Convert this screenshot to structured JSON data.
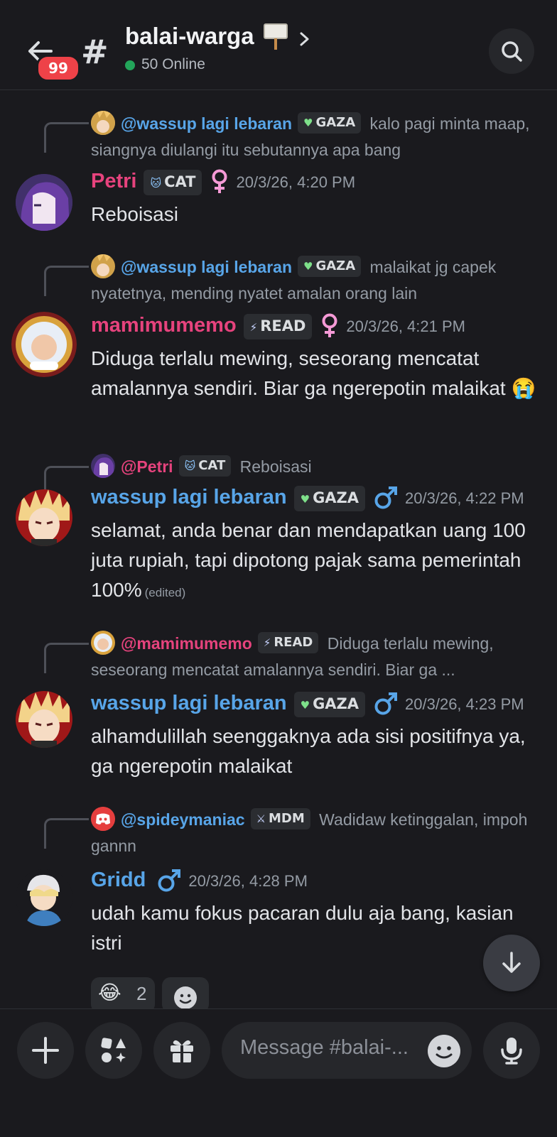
{
  "header": {
    "unread_count": "99",
    "channel_name": "balai-warga",
    "online_text": "50 Online"
  },
  "messages": [
    {
      "reply": {
        "name": "@wassup lagi lebaran",
        "tag": "GAZA",
        "text": "kalo pagi minta maap, siangnya diulangi itu sebutannya apa bang"
      },
      "author": "Petri",
      "tag": "CAT",
      "timestamp": "20/3/26, 4:20 PM",
      "text": "Reboisasi"
    },
    {
      "reply": {
        "name": "@wassup lagi lebaran",
        "tag": "GAZA",
        "text": "malaikat jg capek nyatetnya, mending nyatet amalan orang lain"
      },
      "author": "mamimumemo",
      "tag": "READ",
      "timestamp": "20/3/26, 4:21 PM",
      "text": "Diduga terlalu mewing, seseorang mencatat amalannya sendiri. Biar ga ngerepotin malaikat 😭"
    },
    {
      "reply": {
        "name": "@Petri",
        "tag": "CAT",
        "text": "Reboisasi"
      },
      "author": "wassup lagi lebaran",
      "tag": "GAZA",
      "timestamp": "20/3/26, 4:22 PM",
      "text": "selamat, anda benar dan mendapatkan uang 100 juta rupiah, tapi dipotong pajak sama pemerintah 100%",
      "edited": "(edited)"
    },
    {
      "reply": {
        "name": "@mamimumemo",
        "tag": "READ",
        "text": "Diduga terlalu mewing, seseorang mencatat amalannya sendiri. Biar ga ..."
      },
      "author": "wassup lagi lebaran",
      "tag": "GAZA",
      "timestamp": "20/3/26, 4:23 PM",
      "text": "alhamdulillah seenggaknya ada sisi positifnya ya, ga ngerepotin malaikat"
    },
    {
      "reply": {
        "name": "@spideymaniac",
        "tag": "MDM",
        "text": "Wadidaw ketinggalan, impoh gannn"
      },
      "author": "Gridd",
      "timestamp": "20/3/26, 4:28 PM",
      "text": "udah kamu fokus pacaran dulu aja bang, kasian istri"
    }
  ],
  "reactions": [
    {
      "emoji": "😂",
      "count": "2"
    }
  ],
  "composer": {
    "placeholder": "Message #balai-..."
  },
  "colors": {
    "background": "#1a1a1e",
    "pink_name": "#e6437d",
    "blue_name": "#58a5e8",
    "online": "#23a55a",
    "badge": "#ee4248"
  }
}
